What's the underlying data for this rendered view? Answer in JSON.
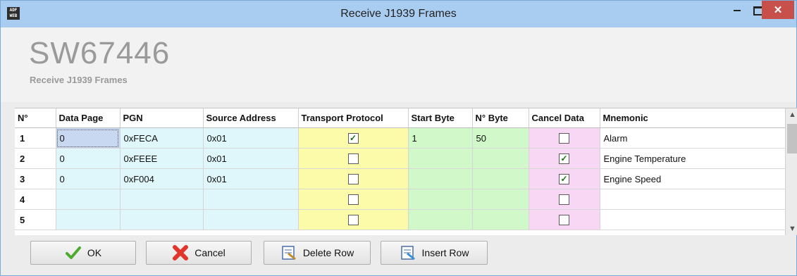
{
  "window": {
    "title": "Receive J1939 Frames",
    "icon_label": "ADF\nWEB",
    "controls": {
      "minimize": "minimize-icon",
      "maximize": "maximize-icon",
      "close": "close-icon"
    }
  },
  "header": {
    "code": "SW67446",
    "subtitle": "Receive J1939 Frames"
  },
  "table": {
    "columns": [
      "N°",
      "Data Page",
      "PGN",
      "Source Address",
      "Transport Protocol",
      "Start Byte",
      "N° Byte",
      "Cancel Data",
      "Mnemonic"
    ],
    "rows": [
      {
        "n": "1",
        "data_page": "0",
        "pgn": "0xFECA",
        "source_address": "0x01",
        "transport_protocol": true,
        "start_byte": "1",
        "n_byte": "50",
        "cancel_data": false,
        "mnemonic": "Alarm"
      },
      {
        "n": "2",
        "data_page": "0",
        "pgn": "0xFEEE",
        "source_address": "0x01",
        "transport_protocol": false,
        "start_byte": "",
        "n_byte": "",
        "cancel_data": true,
        "mnemonic": "Engine Temperature"
      },
      {
        "n": "3",
        "data_page": "0",
        "pgn": "0xF004",
        "source_address": "0x01",
        "transport_protocol": false,
        "start_byte": "",
        "n_byte": "",
        "cancel_data": true,
        "mnemonic": "Engine Speed"
      },
      {
        "n": "4",
        "data_page": "",
        "pgn": "",
        "source_address": "",
        "transport_protocol": false,
        "start_byte": "",
        "n_byte": "",
        "cancel_data": false,
        "mnemonic": ""
      },
      {
        "n": "5",
        "data_page": "",
        "pgn": "",
        "source_address": "",
        "transport_protocol": false,
        "start_byte": "",
        "n_byte": "",
        "cancel_data": false,
        "mnemonic": ""
      }
    ]
  },
  "buttons": {
    "ok": "OK",
    "cancel": "Cancel",
    "delete_row": "Delete Row",
    "insert_row": "Insert Row"
  },
  "colors": {
    "title_bar": "#a9cdf1",
    "close": "#c7504a",
    "col_blue": "#dff6fb",
    "col_yellow": "#fbfba9",
    "col_green": "#d1f8c8",
    "col_pink": "#f8d7f4"
  }
}
